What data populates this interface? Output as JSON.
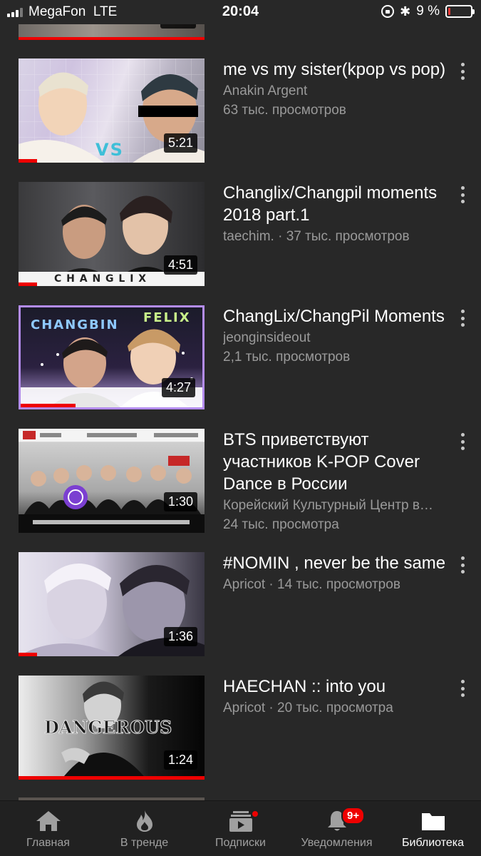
{
  "status_bar": {
    "carrier": "MegaFon",
    "network": "LTE",
    "time": "20:04",
    "battery": "9 %",
    "battery_level": 0.09,
    "bluetooth_icon": "✱"
  },
  "videos": [
    {
      "title": "me vs my sister(kpop vs pop)",
      "channel_line": "Anakin Argent",
      "views_line": "63 тыс. просмотров",
      "duration": "5:21",
      "watched": 0.1,
      "thumb_text": "VS"
    },
    {
      "title": "Changlix/Changpil moments 2018 part.1",
      "channel_line": "taechim. · 37 тыс. просмотров",
      "views_line": "",
      "duration": "4:51",
      "watched": 0.1,
      "thumb_text": "C H A N G L I X"
    },
    {
      "title": "ChangLix/ChangPil Moments",
      "channel_line": "jeonginsideout",
      "views_line": "2,1 тыс. просмотров",
      "duration": "4:27",
      "watched": 0.3,
      "thumb_text_a": "CHANGBIN",
      "thumb_text_b": "FELIX"
    },
    {
      "title": "BTS приветствуют участников K-POP Cover Dance в России",
      "channel_line": "Корейский Культурный Центр в…",
      "views_line": "24 тыс. просмотра",
      "duration": "1:30",
      "watched": 0.0
    },
    {
      "title": "#NOMIN , never be the same",
      "channel_line": "Apricot · 14 тыс. просмотров",
      "views_line": "",
      "duration": "1:36",
      "watched": 0.1
    },
    {
      "title": "HAECHAN :: into you",
      "channel_line": "Apricot · 20 тыс. просмотра",
      "views_line": "",
      "duration": "1:24",
      "watched": 1.0,
      "thumb_text": "DANGEROUS"
    }
  ],
  "tabbar": {
    "home": "Главная",
    "trending": "В тренде",
    "subscriptions": "Подписки",
    "notifications": "Уведомления",
    "notifications_badge": "9+",
    "library": "Библиотека",
    "active_tab": "library",
    "accent": "#e00000"
  }
}
